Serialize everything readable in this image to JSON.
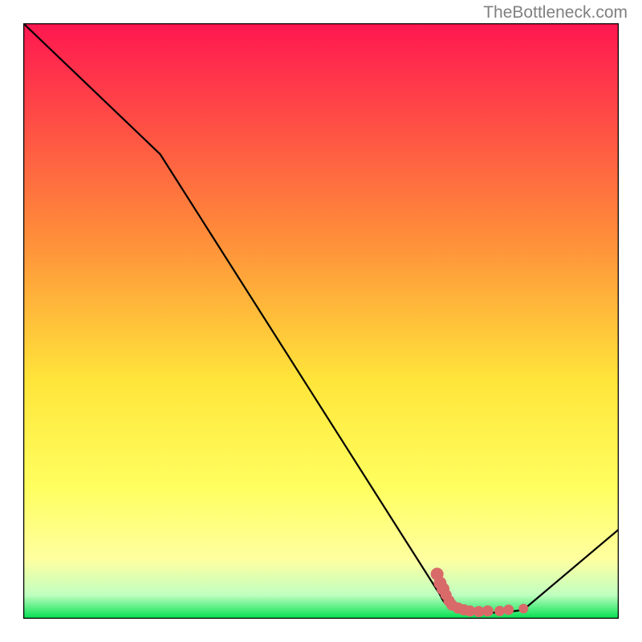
{
  "watermark": "TheBottleneck.com",
  "colors": {
    "gradient_top": "#ff1750",
    "gradient_mid1": "#ff8a3a",
    "gradient_mid2": "#ffe53a",
    "gradient_mid3": "#ffff60",
    "gradient_mid4": "#ffffa0",
    "gradient_mid5": "#c0ffc0",
    "gradient_bottom": "#00e050",
    "line": "#000000",
    "marker": "#d96a6a",
    "border": "#000000"
  },
  "chart_data": {
    "type": "line",
    "title": "",
    "xlabel": "",
    "ylabel": "",
    "xlim": [
      0,
      100
    ],
    "ylim": [
      0,
      100
    ],
    "series": [
      {
        "name": "curve",
        "stroke": "#000000",
        "points": [
          {
            "x": 0,
            "y": 100
          },
          {
            "x": 23,
            "y": 78
          },
          {
            "x": 70,
            "y": 4
          },
          {
            "x": 73,
            "y": 1.5
          },
          {
            "x": 78,
            "y": 1
          },
          {
            "x": 84,
            "y": 1.5
          },
          {
            "x": 100,
            "y": 15
          }
        ]
      }
    ],
    "markers": [
      {
        "x": 69.5,
        "y": 7.5
      },
      {
        "x": 70.0,
        "y": 6.0
      },
      {
        "x": 70.5,
        "y": 5.0
      },
      {
        "x": 71.0,
        "y": 4.0
      },
      {
        "x": 71.5,
        "y": 3.0
      },
      {
        "x": 72.0,
        "y": 2.3
      },
      {
        "x": 73.0,
        "y": 1.8
      },
      {
        "x": 74.0,
        "y": 1.5
      },
      {
        "x": 75.0,
        "y": 1.3
      },
      {
        "x": 76.5,
        "y": 1.2
      },
      {
        "x": 78.0,
        "y": 1.3
      },
      {
        "x": 80.0,
        "y": 1.3
      },
      {
        "x": 81.5,
        "y": 1.5
      },
      {
        "x": 84.0,
        "y": 1.7
      }
    ],
    "grid": false,
    "legend": null
  }
}
